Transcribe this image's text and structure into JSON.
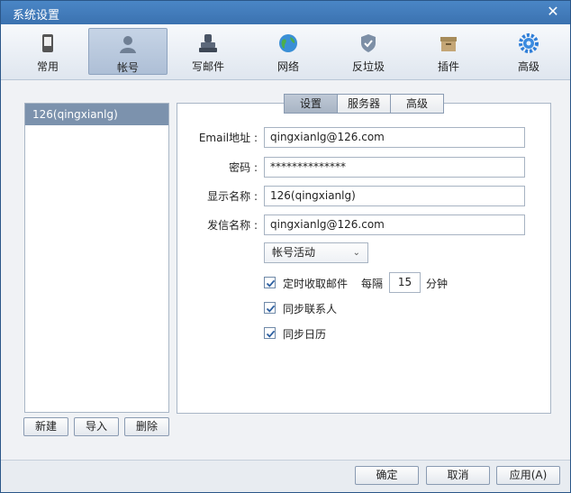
{
  "window": {
    "title": "系统设置",
    "close": "✕"
  },
  "toolbar": {
    "items": [
      {
        "label": "常用",
        "icon": "phone-icon"
      },
      {
        "label": "帐号",
        "icon": "user-icon"
      },
      {
        "label": "写邮件",
        "icon": "stamp-icon"
      },
      {
        "label": "网络",
        "icon": "globe-icon"
      },
      {
        "label": "反垃圾",
        "icon": "shield-icon"
      },
      {
        "label": "插件",
        "icon": "box-icon"
      },
      {
        "label": "高级",
        "icon": "gear-icon"
      }
    ],
    "active_index": 1
  },
  "accounts": {
    "items": [
      "126(qingxianlg)"
    ],
    "buttons": {
      "new": "新建",
      "import": "导入",
      "delete": "删除"
    }
  },
  "tabs": {
    "items": [
      "设置",
      "服务器",
      "高级"
    ],
    "active_index": 0
  },
  "form": {
    "email_label": "Email地址 :",
    "email_value": "qingxianlg@126.com",
    "password_label": "密码 :",
    "password_value": "**************",
    "display_label": "显示名称 :",
    "display_value": "126(qingxianlg)",
    "sender_label": "发信名称 :",
    "sender_value": "qingxianlg@126.com",
    "activity_select": "帐号活动",
    "auto_receive_label": "定时收取邮件",
    "auto_receive_checked": true,
    "interval_prefix": "每隔",
    "interval_value": "15",
    "interval_unit": "分钟",
    "sync_contacts_label": "同步联系人",
    "sync_contacts_checked": true,
    "sync_calendar_label": "同步日历",
    "sync_calendar_checked": true
  },
  "footer": {
    "ok": "确定",
    "cancel": "取消",
    "apply": "应用(A)"
  }
}
